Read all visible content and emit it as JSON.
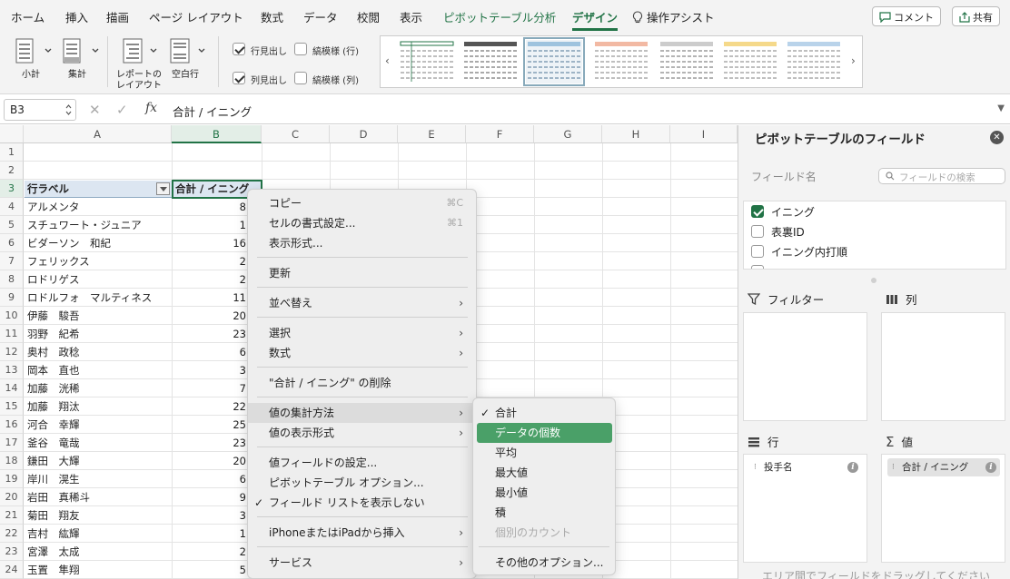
{
  "tabs": [
    {
      "label": "ホーム",
      "state": "normal"
    },
    {
      "label": "挿入",
      "state": "normal"
    },
    {
      "label": "描画",
      "state": "normal"
    },
    {
      "label": "ページ レイアウト",
      "state": "normal"
    },
    {
      "label": "数式",
      "state": "normal"
    },
    {
      "label": "データ",
      "state": "normal"
    },
    {
      "label": "校閲",
      "state": "normal"
    },
    {
      "label": "表示",
      "state": "normal"
    },
    {
      "label": "ピボットテーブル分析",
      "state": "green"
    },
    {
      "label": "デザイン",
      "state": "active"
    }
  ],
  "assist_label": "操作アシスト",
  "comment_label": "コメント",
  "share_label": "共有",
  "ribbon": {
    "subtotal_label": "小計",
    "grandtotal_label": "集計",
    "report_layout_label_1": "レポートの",
    "report_layout_label_2": "レイアウト",
    "blank_rows_label": "空白行",
    "row_headers_label": "行見出し",
    "col_headers_label": "列見出し",
    "banded_rows_label": "縞模様 (行)",
    "banded_cols_label": "縞模様 (列)",
    "row_headers_checked": true,
    "col_headers_checked": true,
    "banded_rows_checked": false,
    "banded_cols_checked": false
  },
  "formula_bar": {
    "cell_ref": "B3",
    "formula": "合計 / イニング"
  },
  "columns": [
    "A",
    "B",
    "C",
    "D",
    "E",
    "F",
    "G",
    "H",
    "I"
  ],
  "selected_column": "B",
  "row_numbers": [
    "1",
    "2",
    "3",
    "4",
    "5",
    "6",
    "7",
    "8",
    "9",
    "10",
    "11",
    "12",
    "13",
    "14",
    "15",
    "16",
    "17",
    "18",
    "19",
    "20",
    "21",
    "22",
    "23",
    "24"
  ],
  "selected_row": "3",
  "pivot_header": {
    "row_label": "行ラベル",
    "value_label": "合計 / イニング"
  },
  "pivot_rows": [
    {
      "name": "アルメンタ",
      "value": "8"
    },
    {
      "name": "スチュワート・ジュニア",
      "value": "1"
    },
    {
      "name": "ビダーソン　和紀",
      "value": "16"
    },
    {
      "name": "フェリックス",
      "value": "2"
    },
    {
      "name": "ロドリゲス",
      "value": "2"
    },
    {
      "name": "ロドルフォ　マルティネス",
      "value": "11"
    },
    {
      "name": "伊藤　駿吾",
      "value": "20"
    },
    {
      "name": "羽野　紀希",
      "value": "23"
    },
    {
      "name": "奥村　政稔",
      "value": "6"
    },
    {
      "name": "岡本　直也",
      "value": "3"
    },
    {
      "name": "加藤　洸稀",
      "value": "7"
    },
    {
      "name": "加藤　翔汰",
      "value": "22"
    },
    {
      "name": "河合　幸輝",
      "value": "25"
    },
    {
      "name": "釜谷　竜哉",
      "value": "23"
    },
    {
      "name": "鎌田　大輝",
      "value": "20"
    },
    {
      "name": "岸川　滉生",
      "value": "6"
    },
    {
      "name": "岩田　真稀斗",
      "value": "9"
    },
    {
      "name": "菊田　翔友",
      "value": "3"
    },
    {
      "name": "吉村　紘輝",
      "value": "1"
    },
    {
      "name": "宮澤　太成",
      "value": "2"
    },
    {
      "name": "玉置　隼翔",
      "value": "5"
    }
  ],
  "context_menu": {
    "items": [
      {
        "label": "コピー",
        "shortcut": "⌘C"
      },
      {
        "label": "セルの書式設定...",
        "shortcut": "⌘1"
      },
      {
        "label": "表示形式..."
      },
      {
        "label": "更新"
      },
      {
        "label": "並べ替え",
        "submenu": true
      },
      {
        "label": "選択",
        "submenu": true
      },
      {
        "label": "数式",
        "submenu": true
      },
      {
        "label": "\"合計 / イニング\" の削除"
      },
      {
        "label": "値の集計方法",
        "submenu": true,
        "highlighted": true
      },
      {
        "label": "値の表示形式",
        "submenu": true
      },
      {
        "label": "値フィールドの設定..."
      },
      {
        "label": "ピボットテーブル オプション..."
      },
      {
        "label": "フィールド リストを表示しない",
        "checked": true
      },
      {
        "label": "iPhoneまたはiPadから挿入",
        "submenu": true
      },
      {
        "label": "サービス",
        "submenu": true
      }
    ],
    "checkmark": "✓",
    "arrow": "›"
  },
  "submenu": {
    "items": [
      {
        "label": "合計",
        "checked": true
      },
      {
        "label": "データの個数",
        "selected": true
      },
      {
        "label": "平均"
      },
      {
        "label": "最大値"
      },
      {
        "label": "最小値"
      },
      {
        "label": "積"
      },
      {
        "label": "個別のカウント",
        "disabled": true
      },
      {
        "label": "その他のオプション..."
      }
    ]
  },
  "pane": {
    "title": "ピボットテーブルのフィールド",
    "field_name_label": "フィールド名",
    "search_placeholder": "フィールドの検索",
    "fields": [
      {
        "label": "イニング",
        "checked": true
      },
      {
        "label": "表裏ID",
        "checked": false
      },
      {
        "label": "イニング内打順",
        "checked": false
      }
    ],
    "areas": {
      "filter": "フィルター",
      "columns": "列",
      "rows": "行",
      "values": "値"
    },
    "rows_chip": "投手名",
    "values_chip": "合計 / イニング",
    "drag_hint": "エリア間でフィールドをドラッグしてください"
  },
  "colors": {
    "accent": "#217346",
    "menu_selected": "#4aa068"
  }
}
